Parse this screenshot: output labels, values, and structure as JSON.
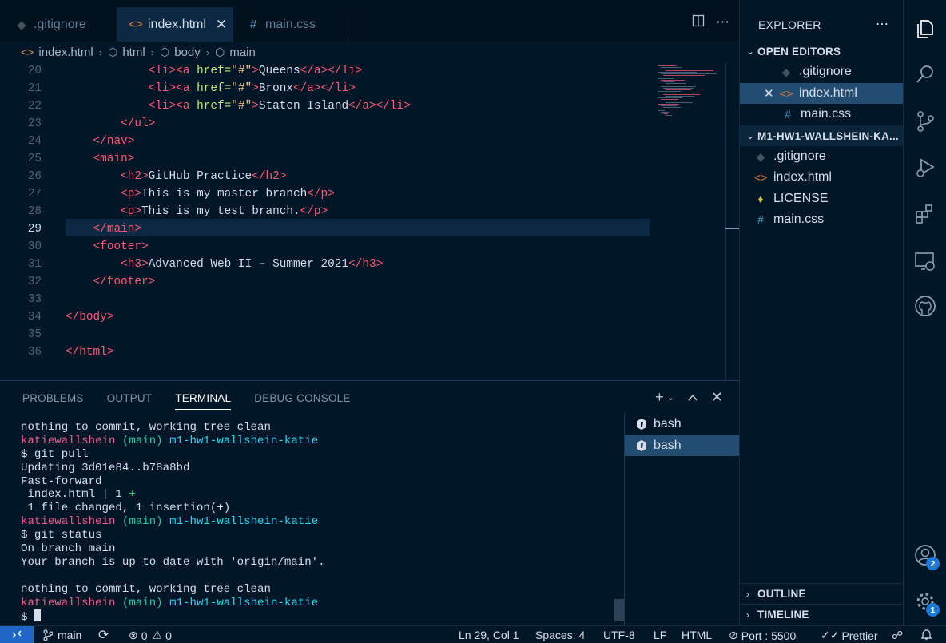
{
  "tabs": [
    {
      "label": ".gitignore",
      "icon": "git-icon",
      "active": false
    },
    {
      "label": "index.html",
      "icon": "html-icon",
      "active": true
    },
    {
      "label": "main.css",
      "icon": "css-icon",
      "active": false
    }
  ],
  "breadcrumb": [
    "index.html",
    "html",
    "body",
    "main"
  ],
  "editor": {
    "current_line": "29",
    "lines": [
      {
        "n": "20",
        "indent": "            ",
        "pre": "<li><a ",
        "attr": "href=",
        "str": "\"#\"",
        "mid": ">",
        "text": "Queens",
        "post": "</a></li>"
      },
      {
        "n": "21",
        "indent": "            ",
        "pre": "<li><a ",
        "attr": "href=",
        "str": "\"#\"",
        "mid": ">",
        "text": "Bronx",
        "post": "</a></li>"
      },
      {
        "n": "22",
        "indent": "            ",
        "pre": "<li><a ",
        "attr": "href=",
        "str": "\"#\"",
        "mid": ">",
        "text": "Staten Island",
        "post": "</a></li>"
      },
      {
        "n": "23",
        "indent": "        ",
        "pre": "</ul>",
        "attr": "",
        "str": "",
        "mid": "",
        "text": "",
        "post": ""
      },
      {
        "n": "24",
        "indent": "    ",
        "pre": "</nav>",
        "attr": "",
        "str": "",
        "mid": "",
        "text": "",
        "post": ""
      },
      {
        "n": "25",
        "indent": "    ",
        "pre": "<main>",
        "attr": "",
        "str": "",
        "mid": "",
        "text": "",
        "post": ""
      },
      {
        "n": "26",
        "indent": "        ",
        "pre": "<h2>",
        "attr": "",
        "str": "",
        "mid": "",
        "text": "GitHub Practice",
        "post": "</h2>"
      },
      {
        "n": "27",
        "indent": "        ",
        "pre": "<p>",
        "attr": "",
        "str": "",
        "mid": "",
        "text": "This is my master branch",
        "post": "</p>"
      },
      {
        "n": "28",
        "indent": "        ",
        "pre": "<p>",
        "attr": "",
        "str": "",
        "mid": "",
        "text": "This is my test branch.",
        "post": "</p>"
      },
      {
        "n": "29",
        "indent": "    ",
        "pre": "</main>",
        "attr": "",
        "str": "",
        "mid": "",
        "text": "",
        "post": ""
      },
      {
        "n": "30",
        "indent": "    ",
        "pre": "<footer>",
        "attr": "",
        "str": "",
        "mid": "",
        "text": "",
        "post": ""
      },
      {
        "n": "31",
        "indent": "        ",
        "pre": "<h3>",
        "attr": "",
        "str": "",
        "mid": "",
        "text": "Advanced Web II – Summer 2021",
        "post": "</h3>"
      },
      {
        "n": "32",
        "indent": "    ",
        "pre": "</footer>",
        "attr": "",
        "str": "",
        "mid": "",
        "text": "",
        "post": ""
      },
      {
        "n": "33",
        "indent": "",
        "pre": "",
        "attr": "",
        "str": "",
        "mid": "",
        "text": "",
        "post": ""
      },
      {
        "n": "34",
        "indent": "",
        "pre": "</body>",
        "attr": "",
        "str": "",
        "mid": "",
        "text": "",
        "post": ""
      },
      {
        "n": "35",
        "indent": "",
        "pre": "",
        "attr": "",
        "str": "",
        "mid": "",
        "text": "",
        "post": ""
      },
      {
        "n": "36",
        "indent": "",
        "pre": "</html>",
        "attr": "",
        "str": "",
        "mid": "",
        "text": "",
        "post": ""
      }
    ]
  },
  "panel": {
    "tabs": [
      "PROBLEMS",
      "OUTPUT",
      "TERMINAL",
      "DEBUG CONSOLE"
    ],
    "active_tab": "TERMINAL",
    "terminals": [
      "bash",
      "bash"
    ],
    "user": "katiewallshein",
    "branch": "(main)",
    "path": "m1-hw1-wallshein-katie",
    "lines": [
      {
        "kind": "text",
        "text": "nothing to commit, working tree clean"
      },
      {
        "kind": "prompt"
      },
      {
        "kind": "text",
        "text": "$ git pull"
      },
      {
        "kind": "text",
        "text": "Updating 3d01e84..b78a8bd"
      },
      {
        "kind": "text",
        "text": "Fast-forward"
      },
      {
        "kind": "diff",
        "text": " index.html | 1 ",
        "plus": "+"
      },
      {
        "kind": "text",
        "text": " 1 file changed, 1 insertion(+)"
      },
      {
        "kind": "prompt"
      },
      {
        "kind": "text",
        "text": "$ git status"
      },
      {
        "kind": "text",
        "text": "On branch main"
      },
      {
        "kind": "text",
        "text": "Your branch is up to date with 'origin/main'."
      },
      {
        "kind": "text",
        "text": ""
      },
      {
        "kind": "text",
        "text": "nothing to commit, working tree clean"
      },
      {
        "kind": "prompt"
      },
      {
        "kind": "cursor",
        "text": "$ "
      }
    ]
  },
  "sidebar": {
    "title": "EXPLORER",
    "open_editors_label": "OPEN EDITORS",
    "open_editors": [
      {
        "label": ".gitignore",
        "icon": "git-icon"
      },
      {
        "label": "index.html",
        "icon": "html-icon"
      },
      {
        "label": "main.css",
        "icon": "css-icon"
      }
    ],
    "folder_label": "M1-HW1-WALLSHEIN-KA...",
    "files": [
      {
        "label": ".gitignore",
        "icon": "git-icon"
      },
      {
        "label": "index.html",
        "icon": "html-icon"
      },
      {
        "label": "LICENSE",
        "icon": "license-icon"
      },
      {
        "label": "main.css",
        "icon": "css-icon"
      }
    ],
    "outline_label": "OUTLINE",
    "timeline_label": "TIMELINE"
  },
  "activity_badges": {
    "accounts": "2",
    "manage": "1"
  },
  "status": {
    "branch": "main",
    "errors": "0",
    "warnings": "0",
    "position": "Ln 29, Col 1",
    "spaces": "Spaces: 4",
    "encoding": "UTF-8",
    "eol": "LF",
    "language": "HTML",
    "port": "Port : 5500",
    "prettier": "Prettier"
  },
  "colors": {
    "accent": "#1f67c7",
    "background": "#011627",
    "tag": "#ff5874",
    "attribute": "#c5e478",
    "string": "#ecc48d"
  }
}
